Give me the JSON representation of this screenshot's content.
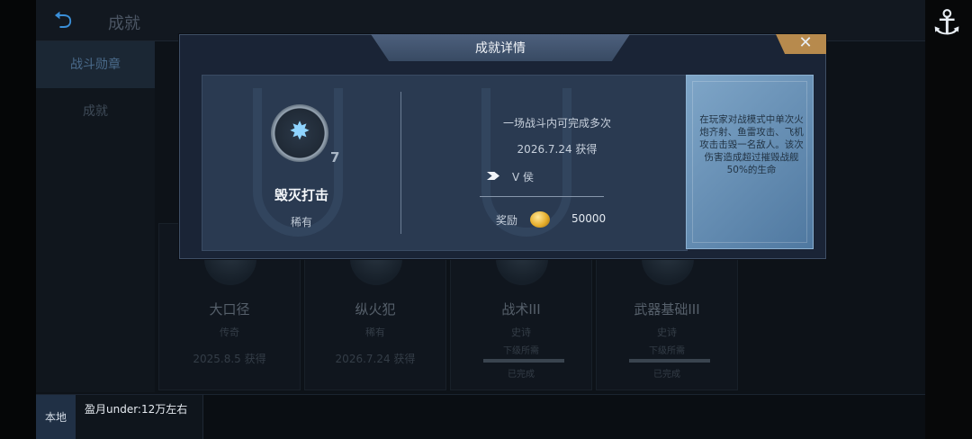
{
  "header": {
    "title": "成就"
  },
  "sidebar": {
    "items": [
      {
        "label": "战斗勋章"
      },
      {
        "label": "成就"
      }
    ]
  },
  "cards": [
    {
      "name": "大口径",
      "rarity": "传奇",
      "date": "2025.8.5  获得"
    },
    {
      "name": "纵火犯",
      "rarity": "稀有",
      "date": "2026.7.24  获得"
    },
    {
      "name": "战术III",
      "rarity": "史诗",
      "sub": "下级所需",
      "done": "已完成"
    },
    {
      "name": "武器基础III",
      "rarity": "史诗",
      "sub": "下级所需",
      "done": "已完成"
    }
  ],
  "bottom": {
    "local_tag": "本地",
    "chat_message": "盈月under:12万左右"
  },
  "modal": {
    "title": "成就详情",
    "close_icon": "close-icon",
    "achievement": {
      "count": "7",
      "name": "毁灭打击",
      "rarity": "稀有",
      "condition": "一场战斗内可完成多次",
      "date": "2026.7.24  获得",
      "rank": "V  侯",
      "reward_label": "奖励",
      "reward_value": "50000",
      "description": "在玩家对战模式中单次火炮齐射、鱼雷攻击、飞机攻击击毁一名敌人。该次伤害造成超过摧毁战舰50%的生命"
    }
  },
  "colors": {
    "accent": "#3a8fd8",
    "close_tab": "#b78a4d",
    "desc_panel": "#6a92b8"
  }
}
